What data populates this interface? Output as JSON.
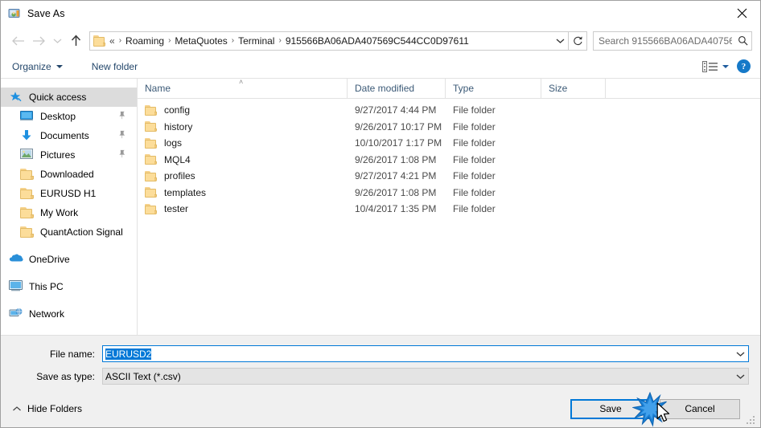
{
  "window": {
    "title": "Save As",
    "title_icon": "save-picture-icon",
    "close_icon": "close-icon"
  },
  "navigation": {
    "back_icon": "back-arrow-icon",
    "forward_icon": "forward-arrow-icon",
    "recent_icon": "chevron-down-icon",
    "up_icon": "up-arrow-icon",
    "address": {
      "folder_icon": "folder-icon",
      "lead": "«",
      "crumbs": [
        "Roaming",
        "MetaQuotes",
        "Terminal",
        "915566BA06ADA407569C544CC0D97611"
      ],
      "separator": "›",
      "dropdown_icon": "chevron-down-icon",
      "refresh_icon": "refresh-icon"
    },
    "search": {
      "placeholder": "Search 915566BA06ADA40756...",
      "value": "",
      "icon": "search-icon"
    }
  },
  "toolbar": {
    "organize_label": "Organize",
    "organize_caret": "chevron-down-icon",
    "new_folder_label": "New folder",
    "view_icon": "view-layout-icon",
    "view_caret": "chevron-down-icon",
    "help_icon": "help-icon",
    "help_label": "?"
  },
  "sidebar": {
    "items": [
      {
        "label": "Quick access",
        "icon": "star-pin-icon",
        "level": 0,
        "selected": true,
        "pinned": false,
        "gap": false
      },
      {
        "label": "Desktop",
        "icon": "desktop-icon",
        "level": 1,
        "selected": false,
        "pinned": true,
        "gap": false
      },
      {
        "label": "Documents",
        "icon": "documents-download-icon",
        "level": 1,
        "selected": false,
        "pinned": true,
        "gap": false
      },
      {
        "label": "Pictures",
        "icon": "pictures-icon",
        "level": 1,
        "selected": false,
        "pinned": true,
        "gap": false
      },
      {
        "label": "Downloaded",
        "icon": "folder-icon",
        "level": 1,
        "selected": false,
        "pinned": false,
        "gap": false
      },
      {
        "label": "EURUSD H1",
        "icon": "folder-icon",
        "level": 1,
        "selected": false,
        "pinned": false,
        "gap": false
      },
      {
        "label": "My Work",
        "icon": "folder-icon",
        "level": 1,
        "selected": false,
        "pinned": false,
        "gap": false
      },
      {
        "label": "QuantAction Signal",
        "icon": "folder-icon",
        "level": 1,
        "selected": false,
        "pinned": false,
        "gap": false
      },
      {
        "label": "OneDrive",
        "icon": "onedrive-cloud-icon",
        "level": 0,
        "selected": false,
        "pinned": false,
        "gap": true
      },
      {
        "label": "This PC",
        "icon": "this-pc-icon",
        "level": 0,
        "selected": false,
        "pinned": false,
        "gap": true
      },
      {
        "label": "Network",
        "icon": "network-icon",
        "level": 0,
        "selected": false,
        "pinned": false,
        "gap": true
      }
    ],
    "pin_glyph": " "
  },
  "filelist": {
    "columns": [
      "Name",
      "Date modified",
      "Type",
      "Size"
    ],
    "sort_indicator": "˄",
    "rows": [
      {
        "name": "config",
        "date": "9/27/2017 4:44 PM",
        "type": "File folder",
        "size": "",
        "icon": "folder-icon"
      },
      {
        "name": "history",
        "date": "9/26/2017 10:17 PM",
        "type": "File folder",
        "size": "",
        "icon": "folder-icon"
      },
      {
        "name": "logs",
        "date": "10/10/2017 1:17 PM",
        "type": "File folder",
        "size": "",
        "icon": "folder-icon"
      },
      {
        "name": "MQL4",
        "date": "9/26/2017 1:08 PM",
        "type": "File folder",
        "size": "",
        "icon": "folder-icon"
      },
      {
        "name": "profiles",
        "date": "9/27/2017 4:21 PM",
        "type": "File folder",
        "size": "",
        "icon": "folder-icon"
      },
      {
        "name": "templates",
        "date": "9/26/2017 1:08 PM",
        "type": "File folder",
        "size": "",
        "icon": "folder-icon"
      },
      {
        "name": "tester",
        "date": "10/4/2017 1:35 PM",
        "type": "File folder",
        "size": "",
        "icon": "folder-icon"
      }
    ]
  },
  "form": {
    "filename_label": "File name:",
    "filename_value": "EURUSD2",
    "filename_selected": true,
    "filetype_label": "Save as type:",
    "filetype_value": "ASCII Text (*.csv)",
    "dropdown_icon": "chevron-down-icon"
  },
  "footer": {
    "hide_folders_label": "Hide Folders",
    "hide_folders_icon": "chevron-up-icon",
    "save_label": "Save",
    "cancel_label": "Cancel",
    "resize_grip_icon": "resize-grip-icon"
  },
  "pointer": {
    "cursor_icon": "mouse-arrow-cursor",
    "click_effect_icon": "click-burst-icon",
    "click_color": "#1a7fd4"
  },
  "colors": {
    "accent": "#0078d7",
    "folder": "#fcdd9a",
    "selection": "#0078d7",
    "header_text": "#3c5a77",
    "toolbar_text": "#24476b"
  }
}
